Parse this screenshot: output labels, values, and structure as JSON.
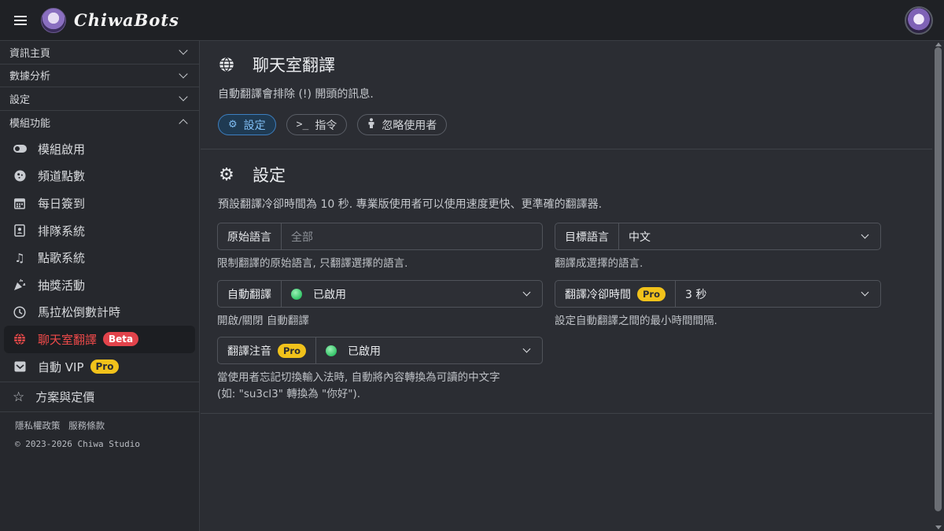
{
  "brand": {
    "name": "ChiwaBots"
  },
  "sidebar": {
    "sections": [
      {
        "label": "資訊主頁",
        "expanded": false
      },
      {
        "label": "數據分析",
        "expanded": false
      },
      {
        "label": "設定",
        "expanded": false
      },
      {
        "label": "模組功能",
        "expanded": true
      }
    ],
    "items": [
      {
        "label": "模組啟用",
        "icon": "toggle-icon"
      },
      {
        "label": "頻道點數",
        "icon": "coin-icon"
      },
      {
        "label": "每日簽到",
        "icon": "calendar-icon"
      },
      {
        "label": "排隊系統",
        "icon": "contact-card-icon"
      },
      {
        "label": "點歌系統",
        "icon": "music-note-icon"
      },
      {
        "label": "抽獎活動",
        "icon": "party-popper-icon"
      },
      {
        "label": "馬拉松倒數計時",
        "icon": "clock-icon"
      },
      {
        "label": "聊天室翻譯",
        "icon": "globe-icon",
        "badge": "Beta",
        "active": true
      },
      {
        "label": "自動 VIP",
        "icon": "inbox-icon",
        "badge": "Pro"
      }
    ],
    "plans_label": "方案與定價",
    "footer_links": [
      "隱私權政策",
      "服務條款"
    ],
    "copyright": "© 2023-2026 Chiwa Studio"
  },
  "page": {
    "title": "聊天室翻譯",
    "description": "自動翻譯會排除 (!) 開頭的訊息.",
    "tabs": [
      {
        "label": "設定",
        "icon": "gear-icon",
        "active": true
      },
      {
        "label": "指令",
        "icon": "terminal-icon"
      },
      {
        "label": "忽略使用者",
        "icon": "person-icon"
      }
    ]
  },
  "settings": {
    "title": "設定",
    "description": "預設翻譯冷卻時間為 10 秒. 專業版使用者可以使用速度更快、更準確的翻譯器.",
    "source_lang": {
      "label": "原始語言",
      "placeholder": "全部",
      "help": "限制翻譯的原始語言, 只翻譯選擇的語言."
    },
    "target_lang": {
      "label": "目標語言",
      "value": "中文",
      "help": "翻譯成選擇的語言."
    },
    "auto_translate": {
      "label": "自動翻譯",
      "value": "已啟用",
      "help": "開啟/關閉 自動翻譯"
    },
    "cooldown": {
      "label": "翻譯冷卻時間",
      "badge": "Pro",
      "value": "3 秒",
      "help": "設定自動翻譯之間的最小時間間隔."
    },
    "zhuyin": {
      "label": "翻譯注音",
      "badge": "Pro",
      "value": "已啟用",
      "help_line1": "當使用者忘記切換輸入法時, 自動將內容轉換為可讀的中文字",
      "help_line2": "(如: \"su3cl3\" 轉換為 \"你好\")."
    }
  },
  "colors": {
    "accent_red": "#ef4a4a",
    "pro_badge": "#f1c21b",
    "active_tab": "#7fbdf3",
    "enabled_dot": "#34c468"
  }
}
